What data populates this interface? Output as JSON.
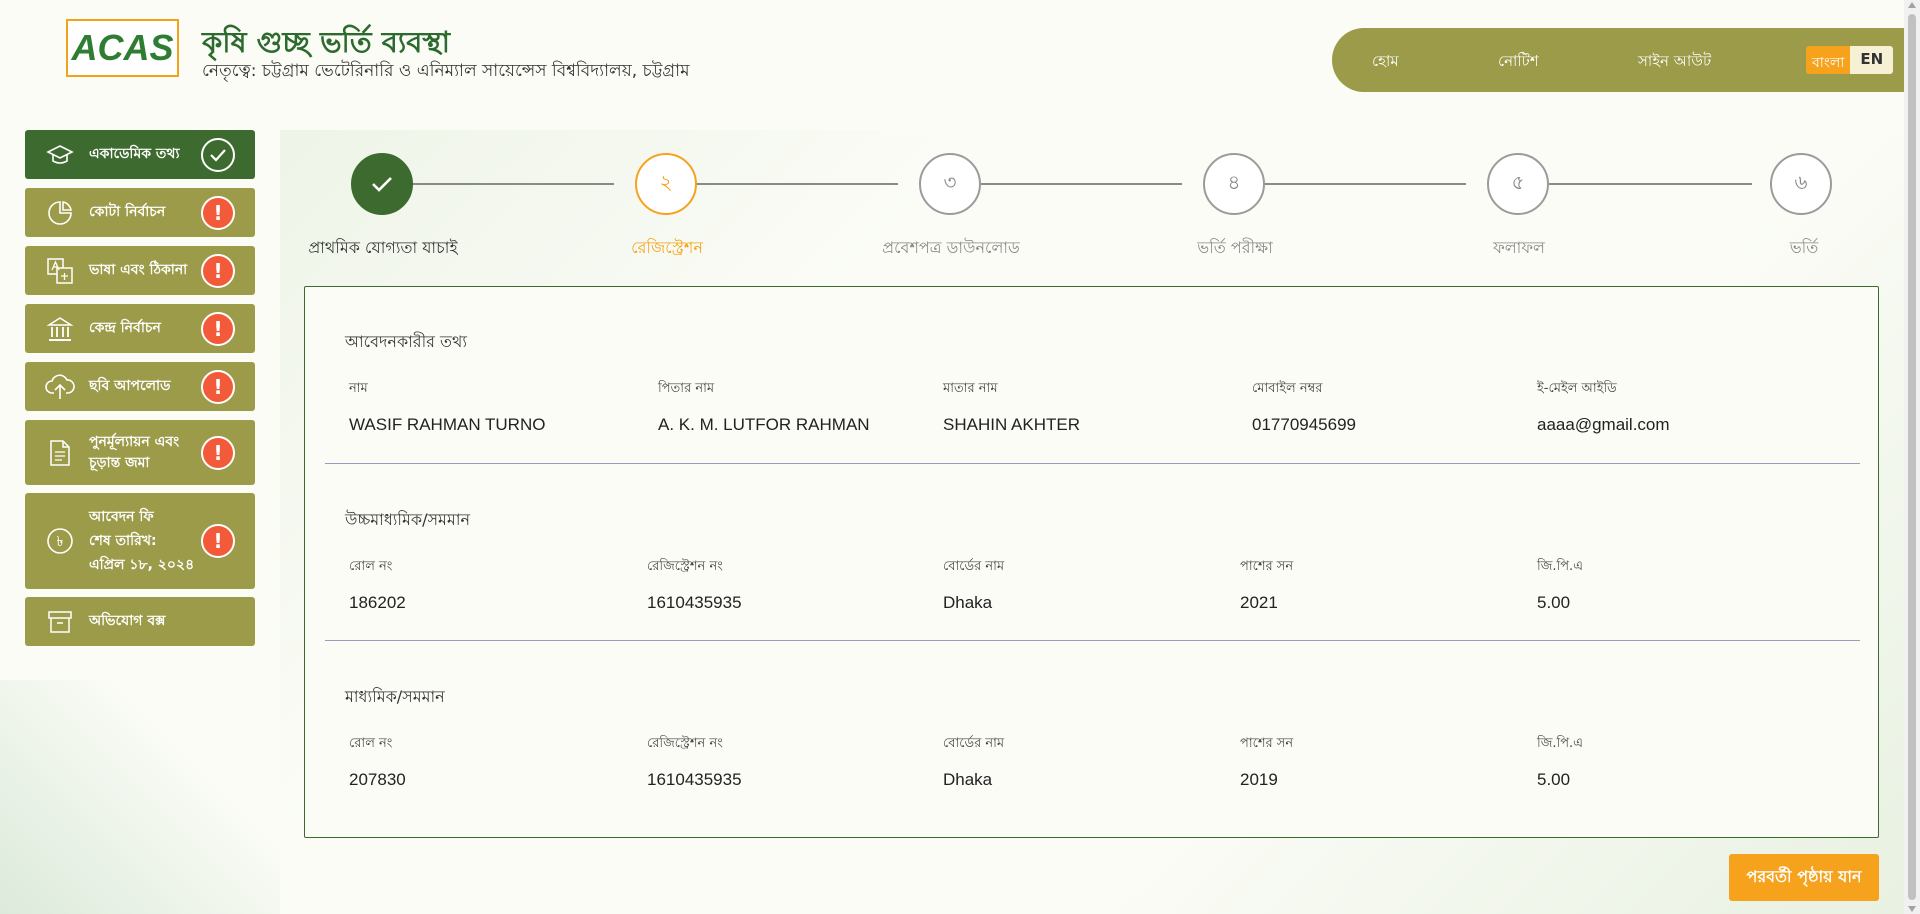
{
  "brand": {
    "logo_text": "ACAS",
    "title": "কৃষি গুচ্ছ ভর্তি ব্যবস্থা",
    "subtitle": "নেতৃত্বে: চট্টগ্রাম ভেটেরিনারি ও এনিম্যাল সায়েন্সেস বিশ্ববিদ্যালয়, চট্টগ্রাম"
  },
  "nav": {
    "home": "হোম",
    "notice": "নোটিশ",
    "signout": "সাইন আউট",
    "lang_bn": "বাংলা",
    "lang_en": "EN"
  },
  "sidebar": {
    "items": [
      {
        "label": "একাডেমিক তথ্য",
        "icon": "graduation-cap-icon",
        "status": "complete"
      },
      {
        "label": "কোটা নির্বাচন",
        "icon": "pie-chart-icon",
        "status": "pending"
      },
      {
        "label": "ভাষা এবং ঠিকানা",
        "icon": "translate-icon",
        "status": "pending"
      },
      {
        "label": "কেন্দ্র নির্বাচন",
        "icon": "bank-icon",
        "status": "pending"
      },
      {
        "label": "ছবি আপলোড",
        "icon": "cloud-upload-icon",
        "status": "pending"
      },
      {
        "label_line1": "পুনর্মূল্যায়ন এবং",
        "label_line2": "চূড়ান্ত জমা",
        "icon": "document-icon",
        "status": "pending"
      },
      {
        "label_line1": "আবেদন ফি",
        "label_line2": "শেষ তারিখ:",
        "label_line3": "এপ্রিল ১৮, ২০২৪",
        "icon": "taka-icon",
        "status": "pending"
      },
      {
        "label": "অভিযোগ বক্স",
        "icon": "archive-box-icon",
        "status": "none"
      }
    ],
    "alert_symbol": "!"
  },
  "stepper": {
    "steps": [
      {
        "number": "",
        "label": "প্রাথমিক যোগ্যতা যাচাই",
        "state": "done"
      },
      {
        "number": "২",
        "label": "রেজিস্ট্রেশন",
        "state": "current"
      },
      {
        "number": "৩",
        "label": "প্রবেশপত্র ডাউনলোড",
        "state": "upcoming"
      },
      {
        "number": "৪",
        "label": "ভর্তি পরীক্ষা",
        "state": "upcoming"
      },
      {
        "number": "৫",
        "label": "ফলাফল",
        "state": "upcoming"
      },
      {
        "number": "৬",
        "label": "ভর্তি",
        "state": "upcoming"
      }
    ]
  },
  "applicant": {
    "section_title": "আবেদনকারীর তথ্য",
    "labels": {
      "name": "নাম",
      "father": "পিতার নাম",
      "mother": "মাতার নাম",
      "mobile": "মোবাইল নম্বর",
      "email": "ই-মেইল আইডি"
    },
    "values": {
      "name": "WASIF RAHMAN TURNO",
      "father": "A. K. M. LUTFOR RAHMAN",
      "mother": "SHAHIN AKHTER",
      "mobile": "01770945699",
      "email": "aaaa@gmail.com"
    }
  },
  "hsc": {
    "section_title": "উচ্চমাধ্যমিক/সমমান",
    "labels": {
      "roll": "রোল নং",
      "reg": "রেজিস্ট্রেশন নং",
      "board": "বোর্ডের নাম",
      "year": "পাশের সন",
      "gpa": "জি.পি.এ"
    },
    "values": {
      "roll": "186202",
      "reg": "1610435935",
      "board": "Dhaka",
      "year": "2021",
      "gpa": "5.00"
    }
  },
  "ssc": {
    "section_title": "মাধ্যমিক/সমমান",
    "labels": {
      "roll": "রোল নং",
      "reg": "রেজিস্ট্রেশন নং",
      "board": "বোর্ডের নাম",
      "year": "পাশের সন",
      "gpa": "জি.পি.এ"
    },
    "values": {
      "roll": "207830",
      "reg": "1610435935",
      "board": "Dhaka",
      "year": "2019",
      "gpa": "5.00"
    }
  },
  "actions": {
    "next": "পরবর্তী পৃষ্ঠায় যান"
  },
  "colors": {
    "primary_olive": "#9b9b49",
    "active_green": "#3c6a2f",
    "accent_orange": "#f6a21c",
    "alert_red": "#f25a3a"
  }
}
